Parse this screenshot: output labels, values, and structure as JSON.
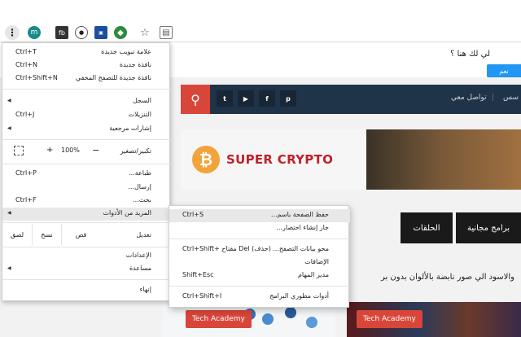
{
  "toolbar": {
    "avatar_letter": "m",
    "menu_glyph": "⋮",
    "star_glyph": "☆",
    "icons": [
      "menu-icon",
      "avatar",
      "extension-icon",
      "extension-icon",
      "extension-icon",
      "extension-icon",
      "bookmark-star-icon",
      "extension-icon"
    ]
  },
  "notice": {
    "text": "لي لك هنا ؟",
    "button_label": "نعم"
  },
  "navbar": {
    "social": [
      "t",
      "▶",
      "f",
      "p"
    ],
    "contact": "تواصل معي",
    "separator": "|",
    "more": "سس"
  },
  "banner": {
    "coin_symbol": "₿",
    "title": "SUPER CRYPTO"
  },
  "tabs": {
    "episodes": "الحلقات",
    "free_programs": "برامج مجانية"
  },
  "headline": "والاسود الي صور نابضة بالألوان بدون بر",
  "thumbs": {
    "badge1": "Tech Academy",
    "badge2": "Tech Academy"
  },
  "chrome_menu": {
    "items": [
      {
        "label": "علامة تبويب جديدة",
        "shortcut": "Ctrl+T"
      },
      {
        "label": "نافذة جديدة",
        "shortcut": "Ctrl+N"
      },
      {
        "label": "نافذة جديدة للتصفح المخفي",
        "shortcut": "Ctrl+Shift+N"
      },
      {
        "label": "السجل",
        "shortcut": ""
      },
      {
        "label": "التنزيلات",
        "shortcut": "Ctrl+J"
      },
      {
        "label": "إشارات مرجعية",
        "shortcut": ""
      },
      {
        "label": "طباعة...",
        "shortcut": "Ctrl+P"
      },
      {
        "label": "إرسال...",
        "shortcut": ""
      },
      {
        "label": "بحث...",
        "shortcut": "Ctrl+F"
      },
      {
        "label": "المزيد من الأدوات",
        "shortcut": ""
      },
      {
        "label": "الإعدادات",
        "shortcut": ""
      },
      {
        "label": "مساعدة",
        "shortcut": ""
      },
      {
        "label": "إنهاء",
        "shortcut": ""
      }
    ],
    "zoom": {
      "label": "تكبير/تصغير",
      "plus": "+",
      "value": "100%",
      "minus": "−"
    },
    "edit": {
      "label": "تعديل",
      "cut": "قص",
      "copy": "نسخ",
      "paste": "لصق"
    },
    "submenu_arrow": "◀"
  },
  "submenu": {
    "items": [
      {
        "label": "حفظ الصفحة باسم...",
        "shortcut": "Ctrl+S"
      },
      {
        "label": "جار إنشاء اختصار...",
        "shortcut": ""
      },
      {
        "label": "محو بيانات التصفح...",
        "shortcut": "Ctrl+Shift+ مفتاح Del (حذف)"
      },
      {
        "label": "الإضافات",
        "shortcut": ""
      },
      {
        "label": "مدير المهام",
        "shortcut": "Shift+Esc"
      },
      {
        "label": "أدوات مطوري البرامج",
        "shortcut": "Ctrl+Shift+I"
      }
    ]
  }
}
